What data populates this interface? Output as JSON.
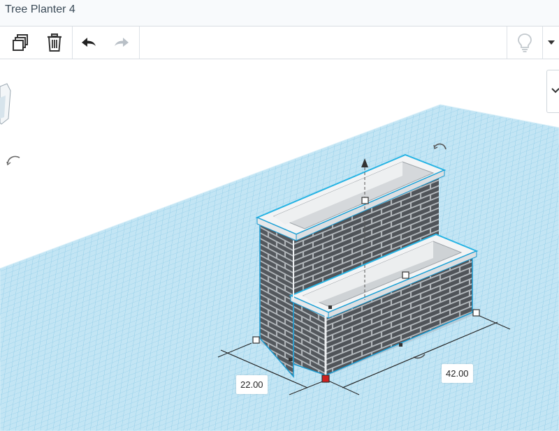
{
  "app": {
    "document_title": "Tree Planter 4"
  },
  "toolbar": {
    "icons": [
      "copy-icon",
      "trash-icon",
      "undo-icon",
      "redo-icon",
      "lightbulb-icon",
      "dropdown-arrow-icon"
    ]
  },
  "dimensions": {
    "width_label": "22.00",
    "length_label": "42.00"
  },
  "colors": {
    "grid_fill": "#bfe3f3",
    "grid_line": "#8fcbe6",
    "brick": "#55595e",
    "mortar": "#b8bcc0",
    "selection_outline": "#24b3e3",
    "rim": "#f2f3f4",
    "handle_origin": "#d0201e"
  }
}
